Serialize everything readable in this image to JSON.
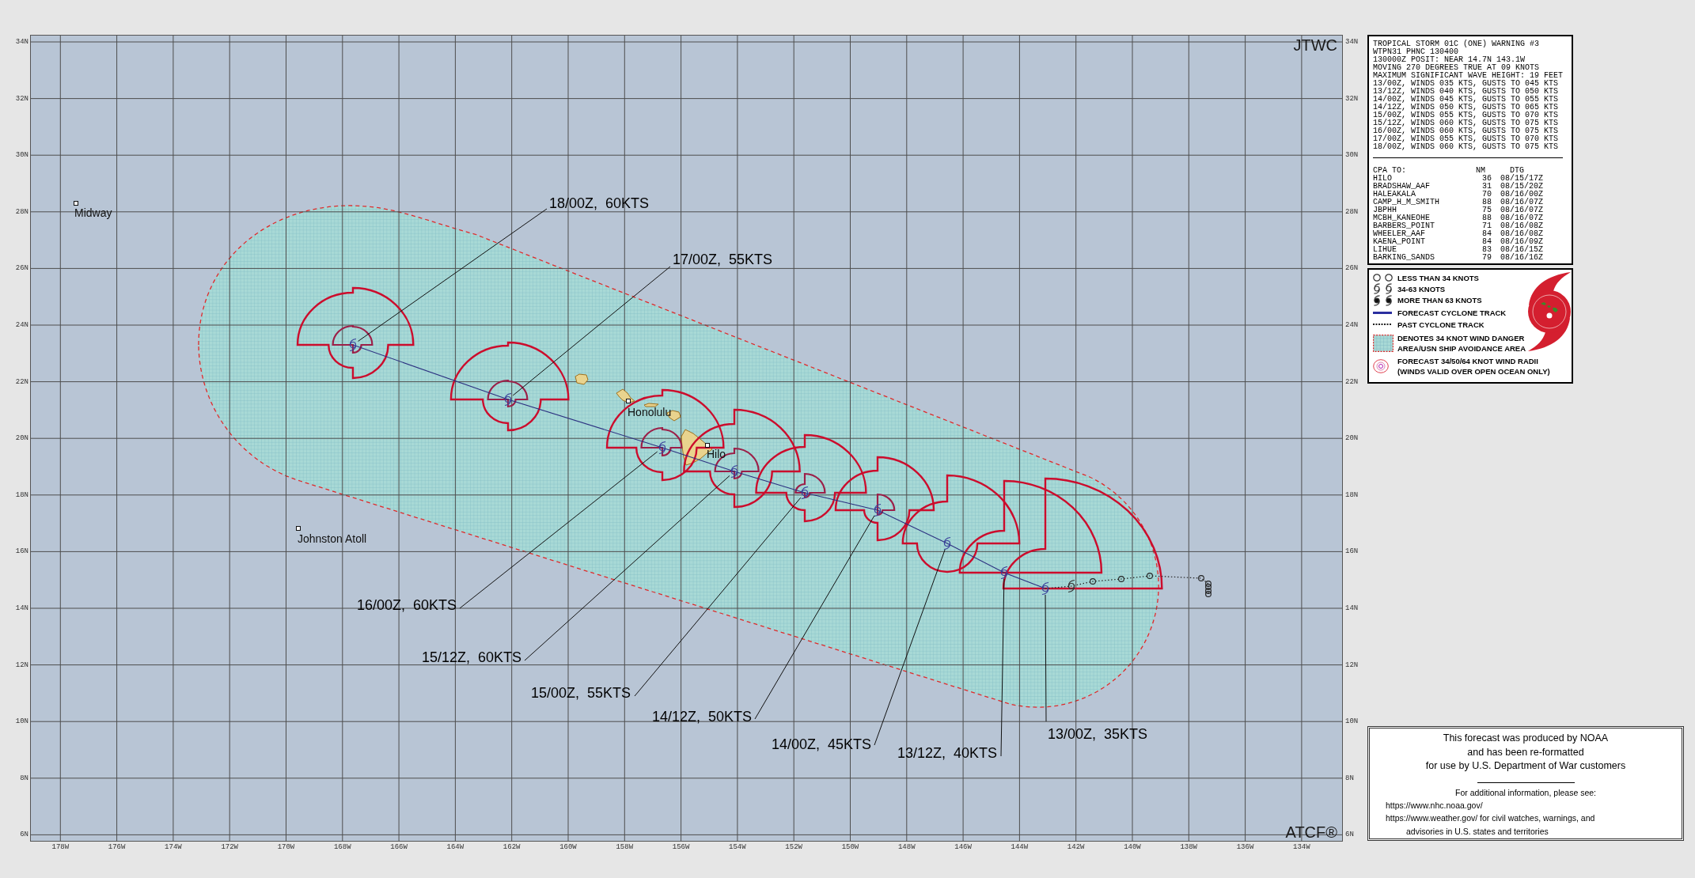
{
  "map": {
    "top_right_label": "JTWC",
    "bottom_right_label": "ATCF®",
    "latitude_labels_left": [
      "34N",
      "32N",
      "30N",
      "28N",
      "26N",
      "24N",
      "22N",
      "20N",
      "18N",
      "16N",
      "14N",
      "12N",
      "10N",
      "8N",
      "6N"
    ],
    "latitude_labels_right": [
      "34N",
      "32N",
      "30N",
      "28N",
      "26N",
      "24N",
      "22N",
      "20N",
      "18N",
      "16N",
      "14N",
      "12N",
      "10N",
      "8N",
      "6N"
    ],
    "longitude_labels": [
      "178W",
      "176W",
      "174W",
      "172W",
      "170W",
      "168W",
      "166W",
      "164W",
      "162W",
      "160W",
      "158W",
      "156W",
      "154W",
      "152W",
      "150W",
      "148W",
      "146W",
      "144W",
      "142W",
      "140W",
      "138W",
      "136W",
      "134W"
    ],
    "places": [
      "Midway",
      "Johnston Atoll",
      "Honolulu",
      "Hilo"
    ],
    "forecast_labels": [
      "13/00Z, 35KTS",
      "13/12Z, 40KTS",
      "14/00Z, 45KTS",
      "14/12Z, 50KTS",
      "15/00Z, 55KTS",
      "15/12Z, 60KTS",
      "16/00Z, 60KTS",
      "17/00Z, 55KTS",
      "18/00Z, 60KTS"
    ]
  },
  "warning": {
    "lines": [
      "TROPICAL STORM 01C (ONE) WARNING #3",
      "WTPN31 PHNC 130400",
      "130000Z POSIT: NEAR 14.7N 143.1W",
      "MOVING 270 DEGREES TRUE AT 09 KNOTS",
      "MAXIMUM SIGNIFICANT WAVE HEIGHT: 19 FEET",
      "13/00Z, WINDS 035 KTS, GUSTS TO 045 KTS",
      "13/12Z, WINDS 040 KTS, GUSTS TO 050 KTS",
      "14/00Z, WINDS 045 KTS, GUSTS TO 055 KTS",
      "14/12Z, WINDS 050 KTS, GUSTS TO 065 KTS",
      "15/00Z, WINDS 055 KTS, GUSTS TO 070 KTS",
      "15/12Z, WINDS 060 KTS, GUSTS TO 075 KTS",
      "16/00Z, WINDS 060 KTS, GUSTS TO 075 KTS",
      "17/00Z, WINDS 055 KTS, GUSTS TO 070 KTS",
      "18/00Z, WINDS 060 KTS, GUSTS TO 075 KTS"
    ],
    "cpa_header": {
      "place": "CPA TO:",
      "nm": "NM",
      "dtg": "DTG"
    },
    "cpa_rows": [
      {
        "place": "HILO",
        "nm": "36",
        "dtg": "08/15/17Z"
      },
      {
        "place": "BRADSHAW_AAF",
        "nm": "31",
        "dtg": "08/15/20Z"
      },
      {
        "place": "HALEAKALA",
        "nm": "70",
        "dtg": "08/16/00Z"
      },
      {
        "place": "CAMP_H_M_SMITH",
        "nm": "88",
        "dtg": "08/16/07Z"
      },
      {
        "place": "JBPHH",
        "nm": "75",
        "dtg": "08/16/07Z"
      },
      {
        "place": "MCBH_KANEOHE",
        "nm": "88",
        "dtg": "08/16/07Z"
      },
      {
        "place": "BARBERS_POINT",
        "nm": "71",
        "dtg": "08/16/08Z"
      },
      {
        "place": "WHEELER_AAF",
        "nm": "84",
        "dtg": "08/16/08Z"
      },
      {
        "place": "KAENA_POINT",
        "nm": "84",
        "dtg": "08/16/09Z"
      },
      {
        "place": "LIHUE",
        "nm": "83",
        "dtg": "08/16/15Z"
      },
      {
        "place": "BARKING_SANDS",
        "nm": "79",
        "dtg": "08/16/16Z"
      }
    ]
  },
  "legend": {
    "items": [
      {
        "kind": "open_circle",
        "lines": [
          "LESS THAN 34 KNOTS"
        ]
      },
      {
        "kind": "storm_symbol",
        "lines": [
          "34-63 KNOTS"
        ]
      },
      {
        "kind": "filled_symbol",
        "lines": [
          "MORE THAN 63 KNOTS"
        ]
      },
      {
        "kind": "forecast_track",
        "lines": [
          "FORECAST CYCLONE TRACK"
        ]
      },
      {
        "kind": "past_track",
        "lines": [
          "PAST CYCLONE TRACK"
        ]
      },
      {
        "kind": "danger_area",
        "lines": [
          "DENOTES 34 KNOT WIND DANGER",
          "AREA/USN SHIP AVOIDANCE AREA"
        ]
      },
      {
        "kind": "wind_radii",
        "lines": [
          "FORECAST 34/50/64 KNOT WIND RADII",
          "(WINDS VALID OVER OPEN OCEAN ONLY)"
        ]
      }
    ]
  },
  "notice": {
    "lines": [
      "This forecast was produced by NOAA",
      "and has been re-formatted",
      "for use by U.S. Department of War customers"
    ],
    "info_heading": "For additional information, please see:",
    "sources": [
      "https://www.nhc.noaa.gov/",
      "https://www.weather.gov/ for civil watches, warnings, and advisories in U.S. states and territories"
    ]
  }
}
